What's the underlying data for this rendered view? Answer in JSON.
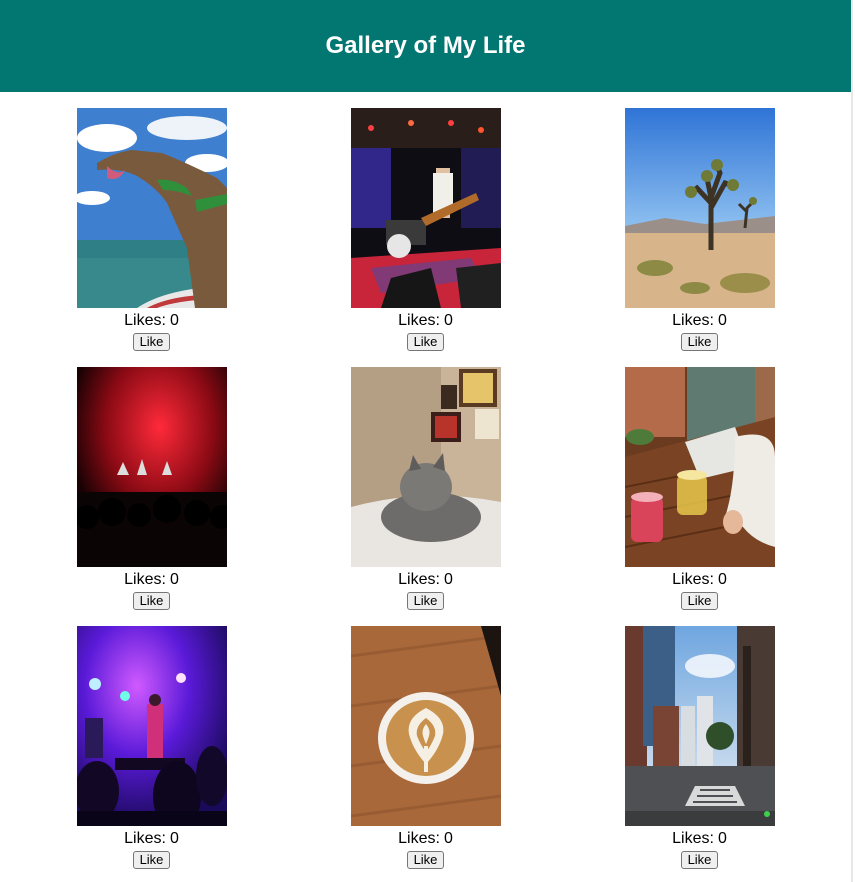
{
  "header": {
    "title": "Gallery of My Life"
  },
  "gallery": {
    "items": [
      {
        "subject": "greyhound dog on boat",
        "likes_label": "Likes:",
        "likes": 0,
        "button_label": "Like"
      },
      {
        "subject": "band playing on stage",
        "likes_label": "Likes:",
        "likes": 0,
        "button_label": "Like"
      },
      {
        "subject": "joshua tree in desert",
        "likes_label": "Likes:",
        "likes": 0,
        "button_label": "Like"
      },
      {
        "subject": "concert with red lights",
        "likes_label": "Likes:",
        "likes": 0,
        "button_label": "Like"
      },
      {
        "subject": "grey fluffy cat on bed",
        "likes_label": "Likes:",
        "likes": 0,
        "button_label": "Like"
      },
      {
        "subject": "drinks on wooden table",
        "likes_label": "Likes:",
        "likes": 0,
        "button_label": "Like"
      },
      {
        "subject": "concert with purple lights",
        "likes_label": "Likes:",
        "likes": 0,
        "button_label": "Like"
      },
      {
        "subject": "latte art coffee",
        "likes_label": "Likes:",
        "likes": 0,
        "button_label": "Like"
      },
      {
        "subject": "city street with tall buildings",
        "likes_label": "Likes:",
        "likes": 0,
        "button_label": "Like"
      }
    ]
  },
  "colors": {
    "header_bg": "#027670",
    "header_text": "#ffffff"
  }
}
